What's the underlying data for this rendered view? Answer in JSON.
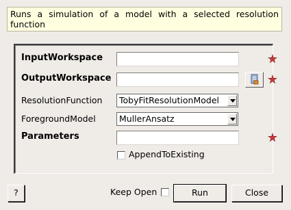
{
  "description": "Runs a simulation of a model with a selected resolution function",
  "fields": {
    "input_workspace": {
      "label": "InputWorkspace",
      "value": ""
    },
    "output_workspace": {
      "label": "OutputWorkspace",
      "value": ""
    },
    "resolution_function": {
      "label": "ResolutionFunction",
      "selected": "TobyFitResolutionModel"
    },
    "foreground_model": {
      "label": "ForegroundModel",
      "selected": "MullerAnsatz"
    },
    "parameters": {
      "label": "Parameters",
      "value": ""
    },
    "append_to_existing": {
      "label": "AppendToExisting",
      "checked": false
    }
  },
  "footer": {
    "help_label": "?",
    "keep_open_label": "Keep Open",
    "keep_open_checked": false,
    "run_label": "Run",
    "close_label": "Close"
  },
  "icons": {
    "required": "red-star-icon",
    "browse": "workspace-browse-icon"
  },
  "colors": {
    "required_star": "#c8383a",
    "description_bg": "#ffffe0",
    "window_bg": "#efebe7"
  }
}
